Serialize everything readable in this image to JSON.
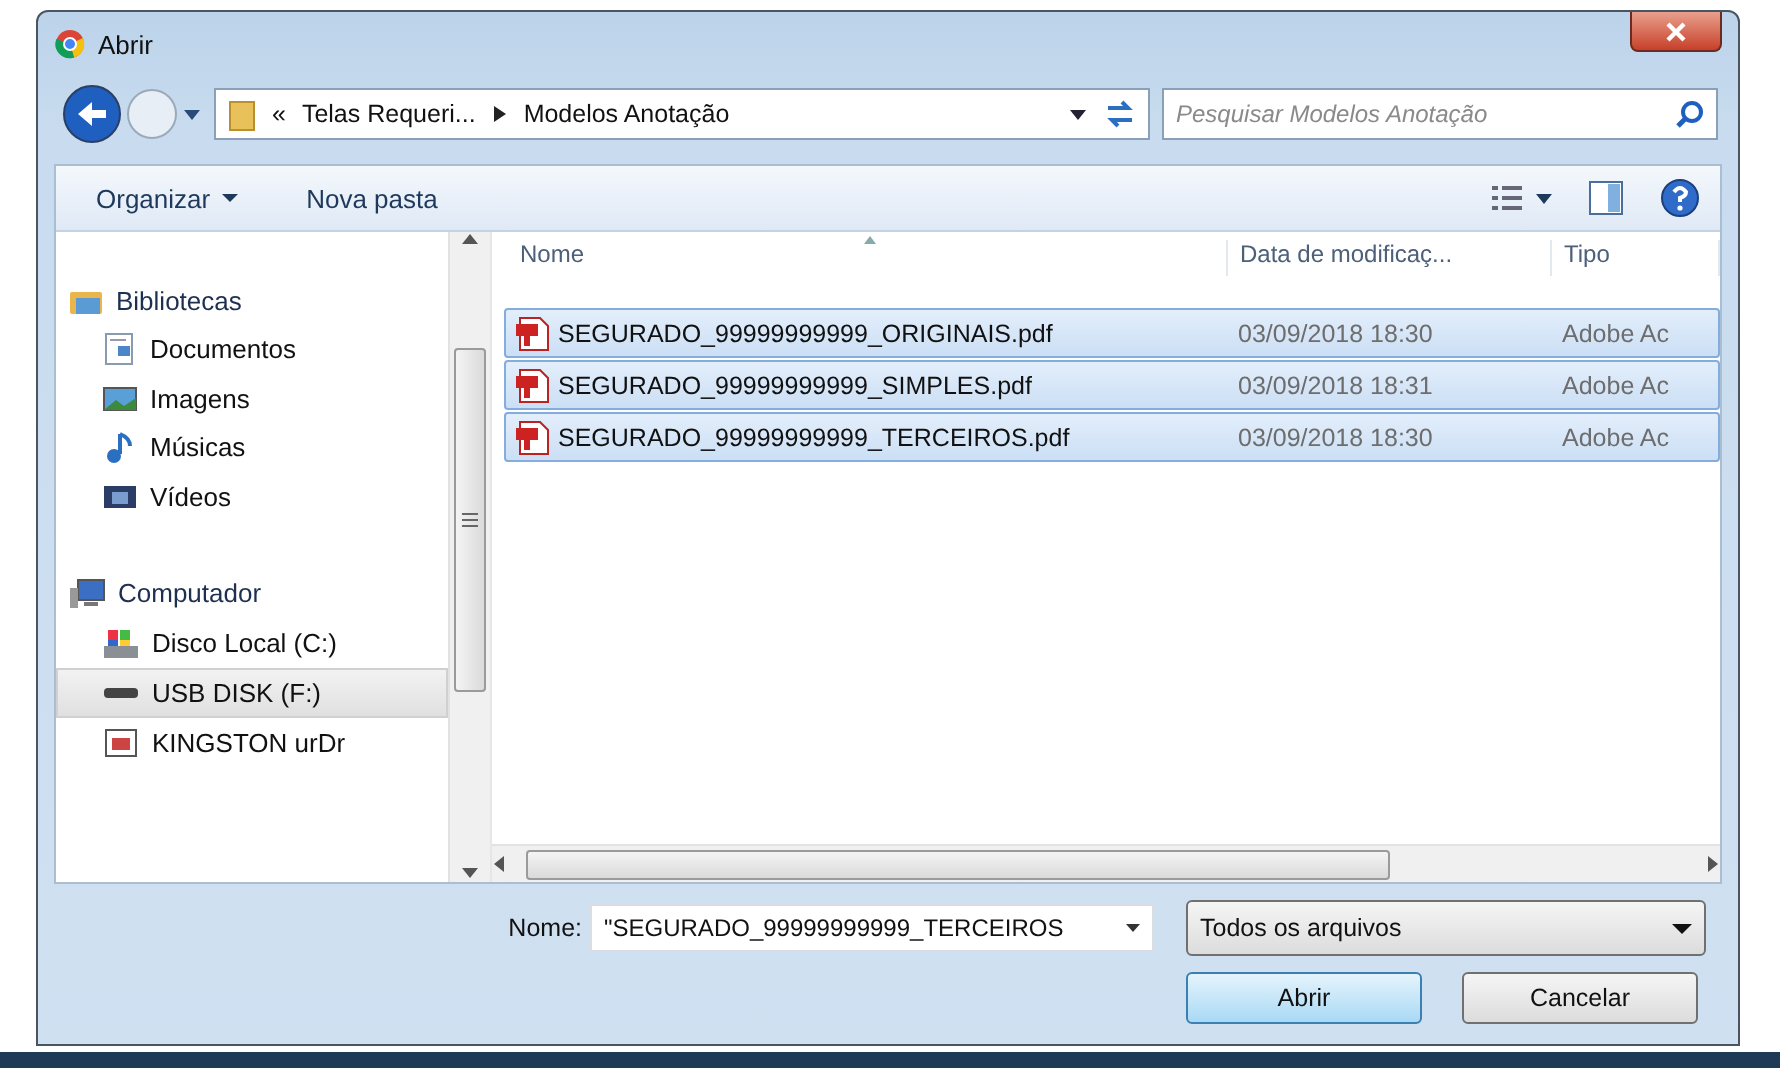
{
  "window": {
    "title": "Abrir"
  },
  "address": {
    "breadcrumbs": [
      "«",
      "Telas Requeri...",
      "Modelos Anotação"
    ]
  },
  "search": {
    "placeholder": "Pesquisar Modelos Anotação"
  },
  "toolbar": {
    "buttons": [
      {
        "label": "Organizar",
        "dropdown": true
      },
      {
        "label": "Nova pasta",
        "dropdown": false
      }
    ]
  },
  "sidebar": {
    "groups": [
      {
        "label": "Bibliotecas",
        "kind": "libraries",
        "selected": false,
        "children": [
          {
            "label": "Documentos",
            "kind": "documents",
            "selected": false
          },
          {
            "label": "Imagens",
            "kind": "pictures",
            "selected": false
          },
          {
            "label": "Músicas",
            "kind": "music",
            "selected": false
          },
          {
            "label": "Vídeos",
            "kind": "videos",
            "selected": false
          }
        ]
      },
      {
        "label": "Computador",
        "kind": "computer",
        "selected": false,
        "children": [
          {
            "label": "Disco Local (C:)",
            "kind": "disk",
            "selected": false
          },
          {
            "label": "USB DISK (F:)",
            "kind": "usb",
            "selected": true
          },
          {
            "label": "KINGSTON urDr",
            "kind": "drive",
            "selected": false
          }
        ]
      }
    ]
  },
  "table": {
    "columns": [
      "Nome",
      "Data de modificaç...",
      "Tipo"
    ],
    "rows": [
      {
        "name": "SEGURADO_99999999999_ORIGINAIS.pdf",
        "date": "03/09/2018 18:30",
        "type": "Adobe Ac",
        "selected": true
      },
      {
        "name": "SEGURADO_99999999999_SIMPLES.pdf",
        "date": "03/09/2018 18:31",
        "type": "Adobe Ac",
        "selected": true
      },
      {
        "name": "SEGURADO_99999999999_TERCEIROS.pdf",
        "date": "03/09/2018 18:30",
        "type": "Adobe Ac",
        "selected": true
      }
    ]
  },
  "filename": {
    "label": "Nome:",
    "value": "\"SEGURADO_99999999999_TERCEIROS"
  },
  "filter": {
    "value": "Todos os arquivos"
  },
  "buttons": [
    {
      "label": "Abrir",
      "default": true
    },
    {
      "label": "Cancelar",
      "default": false
    }
  ]
}
